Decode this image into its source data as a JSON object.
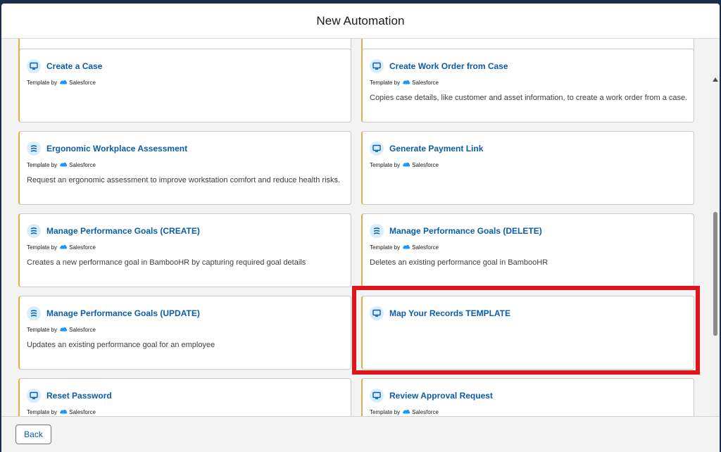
{
  "modal": {
    "title": "New Automation"
  },
  "cards": [
    {
      "title": "Create a Case",
      "icon": "screen-icon",
      "template_by": "Template by",
      "vendor": "Salesforce",
      "description": ""
    },
    {
      "title": "Create Work Order from Case",
      "icon": "screen-icon",
      "template_by": "Template by",
      "vendor": "Salesforce",
      "description": "Copies case details, like customer and asset information, to create a work order from a case."
    },
    {
      "title": "Ergonomic Workplace Assessment",
      "icon": "flow-icon",
      "template_by": "Template by",
      "vendor": "Salesforce",
      "description": "Request an ergonomic assessment to improve workstation comfort and reduce health risks."
    },
    {
      "title": "Generate Payment Link",
      "icon": "screen-icon",
      "template_by": "Template by",
      "vendor": "Salesforce",
      "description": ""
    },
    {
      "title": "Manage Performance Goals (CREATE)",
      "icon": "flow-icon",
      "template_by": "Template by",
      "vendor": "Salesforce",
      "description": "Creates a new performance goal in BambooHR by capturing required goal details"
    },
    {
      "title": "Manage Performance Goals (DELETE)",
      "icon": "flow-icon",
      "template_by": "Template by",
      "vendor": "Salesforce",
      "description": "Deletes an existing performance goal in BambooHR"
    },
    {
      "title": "Manage Performance Goals (UPDATE)",
      "icon": "flow-icon",
      "template_by": "Template by",
      "vendor": "Salesforce",
      "description": "Updates an existing performance goal for an employee"
    },
    {
      "title": "Map Your Records TEMPLATE",
      "icon": "screen-icon",
      "template_by": "",
      "vendor": "",
      "description": ""
    },
    {
      "title": "Reset Password",
      "icon": "screen-icon",
      "template_by": "Template by",
      "vendor": "Salesforce",
      "description": ""
    },
    {
      "title": "Review Approval Request",
      "icon": "screen-icon",
      "template_by": "Template by",
      "vendor": "Salesforce",
      "description": ""
    }
  ],
  "footer": {
    "back_label": "Back"
  },
  "colors": {
    "title_blue": "#0b5cab",
    "highlight": "#e0141a",
    "card_accent": "#d9b24a"
  }
}
